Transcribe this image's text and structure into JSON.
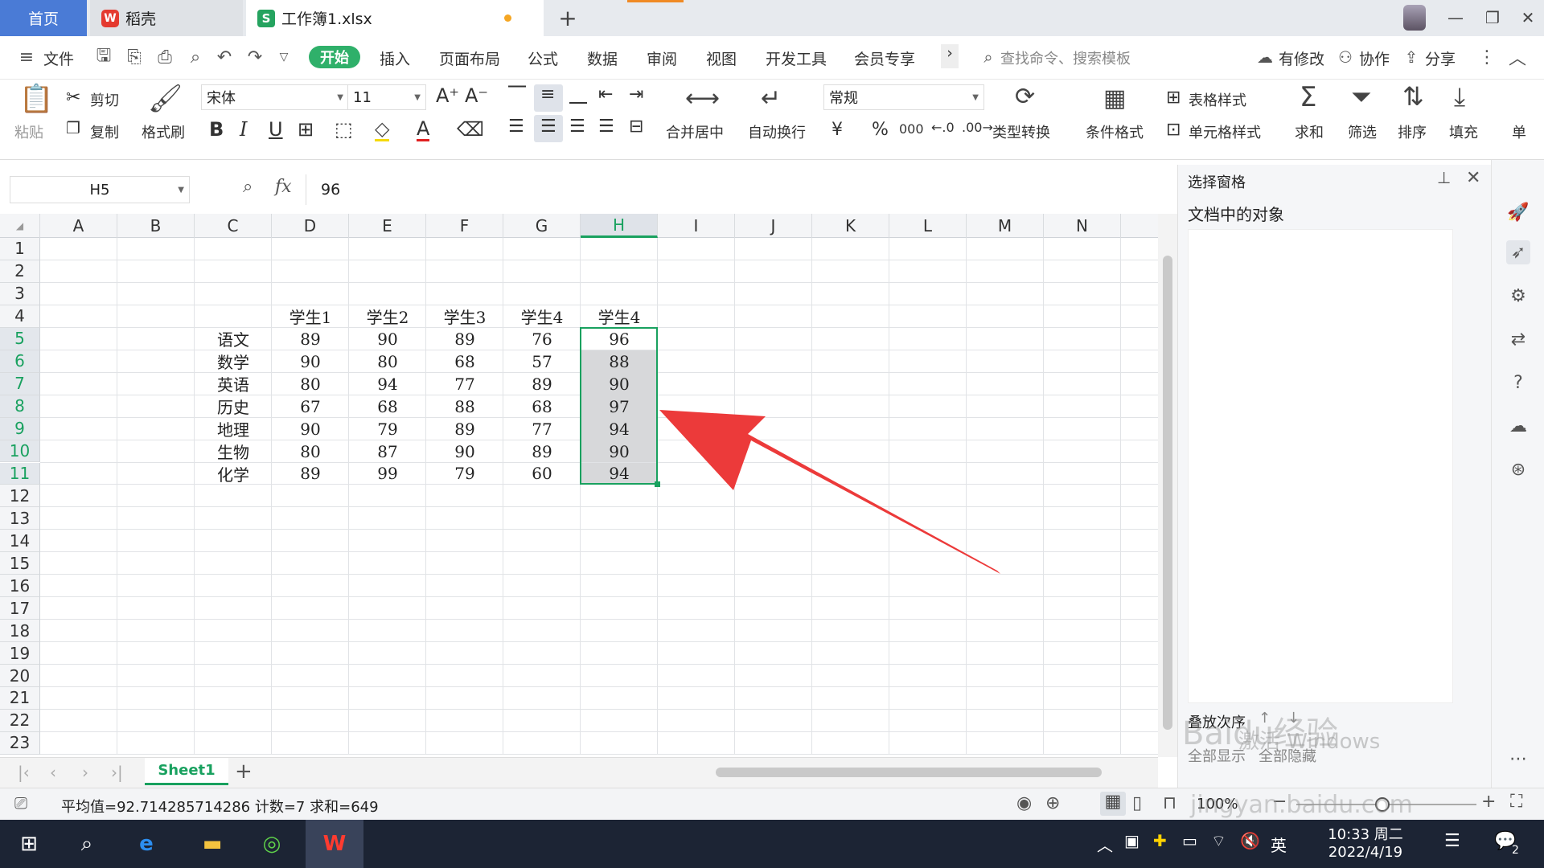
{
  "tabs": {
    "home": "首页",
    "daoke": "稻壳",
    "workbook": "工作簿1.xlsx",
    "add": "+"
  },
  "menu": {
    "file": "文件",
    "items": [
      "开始",
      "插入",
      "页面布局",
      "公式",
      "数据",
      "审阅",
      "视图",
      "开发工具",
      "会员专享"
    ],
    "more": "›",
    "search_placeholder": "查找命令、搜索模板",
    "modified": "有修改",
    "collab": "协作",
    "share": "分享"
  },
  "ribbon": {
    "paste": "粘贴",
    "cut": "剪切",
    "copy": "复制",
    "format_painter": "格式刷",
    "font_name": "宋体",
    "font_size": "11",
    "bold": "B",
    "italic": "I",
    "underline": "U",
    "merge_center": "合并居中",
    "wrap_text": "自动换行",
    "number_format": "常规",
    "currency": "¥",
    "percent": "%",
    "thousands": "000",
    "type_convert": "类型转换",
    "conditional_format": "条件格式",
    "table_style": "表格样式",
    "cell_style": "单元格样式",
    "sum": "求和",
    "filter": "筛选",
    "sort": "排序",
    "fill": "填充",
    "single": "单"
  },
  "formula_bar": {
    "name_box": "H5",
    "fx": "fx",
    "value": "96"
  },
  "sheet": {
    "columns": [
      "A",
      "B",
      "C",
      "D",
      "E",
      "F",
      "G",
      "H",
      "I",
      "J",
      "K",
      "L",
      "M",
      "N"
    ],
    "rows": [
      "1",
      "2",
      "3",
      "4",
      "5",
      "6",
      "7",
      "8",
      "9",
      "10",
      "11",
      "12",
      "13",
      "14",
      "15",
      "16",
      "17",
      "18",
      "19",
      "20",
      "21",
      "22",
      "23"
    ],
    "selected_column": "H",
    "headers": [
      "学生1",
      "学生2",
      "学生3",
      "学生4",
      "学生4"
    ],
    "subjects": [
      "语文",
      "数学",
      "英语",
      "历史",
      "地理",
      "生物",
      "化学"
    ],
    "scores": [
      [
        "89",
        "90",
        "89",
        "76",
        "96"
      ],
      [
        "90",
        "80",
        "68",
        "57",
        "88"
      ],
      [
        "80",
        "94",
        "77",
        "89",
        "90"
      ],
      [
        "67",
        "68",
        "88",
        "68",
        "97"
      ],
      [
        "90",
        "79",
        "89",
        "77",
        "94"
      ],
      [
        "80",
        "87",
        "90",
        "89",
        "90"
      ],
      [
        "89",
        "99",
        "79",
        "60",
        "94"
      ]
    ],
    "tab_name": "Sheet1"
  },
  "pane": {
    "title": "选择窗格",
    "subtitle": "文档中的对象",
    "stack_order": "叠放次序",
    "show_all": "全部显示",
    "hide_all": "全部隐藏"
  },
  "status": {
    "summary": "平均值=92.714285714286  计数=7  求和=649",
    "zoom": "100%"
  },
  "taskbar": {
    "ime": "英",
    "time": "10:33 周二",
    "date": "2022/4/19",
    "notifications": "2"
  },
  "overlay": {
    "watermark": "Baidu经验",
    "watermark_url": "jingyan.baidu.com",
    "activate": "激活 Windows"
  },
  "colors": {
    "accent_green": "#19a15f",
    "arrow_red": "#ec3a3a",
    "home_tab_blue": "#4a7bd6"
  }
}
